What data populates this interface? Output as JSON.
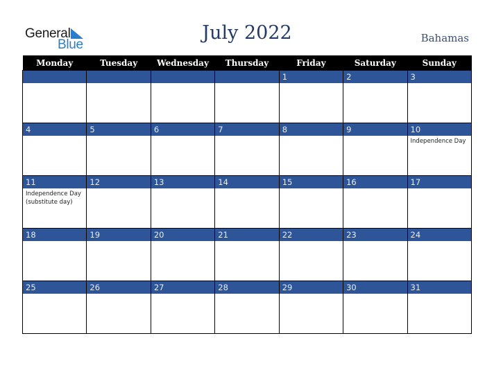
{
  "logo": {
    "general": "General",
    "blue": "Blue",
    "icon": "triangle-flag-icon"
  },
  "title": "July 2022",
  "country": "Bahamas",
  "colors": {
    "header_bg": "#000000",
    "band": "#2e5597",
    "title": "#243a66",
    "logo_blue": "#2a7dc6"
  },
  "weekdays": [
    "Monday",
    "Tuesday",
    "Wednesday",
    "Thursday",
    "Friday",
    "Saturday",
    "Sunday"
  ],
  "weeks": [
    [
      {
        "day": ""
      },
      {
        "day": ""
      },
      {
        "day": ""
      },
      {
        "day": ""
      },
      {
        "day": "1"
      },
      {
        "day": "2"
      },
      {
        "day": "3"
      }
    ],
    [
      {
        "day": "4"
      },
      {
        "day": "5"
      },
      {
        "day": "6"
      },
      {
        "day": "7"
      },
      {
        "day": "8"
      },
      {
        "day": "9"
      },
      {
        "day": "10",
        "event": "Independence Day"
      }
    ],
    [
      {
        "day": "11",
        "event": "Independence Day (substitute day)"
      },
      {
        "day": "12"
      },
      {
        "day": "13"
      },
      {
        "day": "14"
      },
      {
        "day": "15"
      },
      {
        "day": "16"
      },
      {
        "day": "17"
      }
    ],
    [
      {
        "day": "18"
      },
      {
        "day": "19"
      },
      {
        "day": "20"
      },
      {
        "day": "21"
      },
      {
        "day": "22"
      },
      {
        "day": "23"
      },
      {
        "day": "24"
      }
    ],
    [
      {
        "day": "25"
      },
      {
        "day": "26"
      },
      {
        "day": "27"
      },
      {
        "day": "28"
      },
      {
        "day": "29"
      },
      {
        "day": "30"
      },
      {
        "day": "31"
      }
    ]
  ]
}
